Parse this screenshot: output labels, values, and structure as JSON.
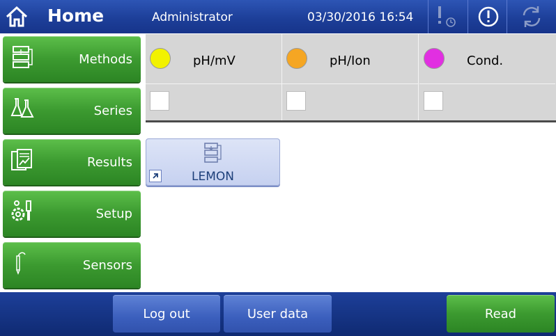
{
  "header": {
    "title": "Home",
    "user": "Administrator",
    "datetime": "03/30/2016 16:54",
    "icons": [
      "home-icon",
      "alarm-clock-icon",
      "info-icon",
      "refresh-icon"
    ]
  },
  "sidebar": {
    "items": [
      {
        "label": "Methods",
        "icon": "methods-icon"
      },
      {
        "label": "Series",
        "icon": "flasks-icon"
      },
      {
        "label": "Results",
        "icon": "results-icon"
      },
      {
        "label": "Setup",
        "icon": "setup-icon"
      },
      {
        "label": "Sensors",
        "icon": "sensor-probe-icon"
      }
    ]
  },
  "sensors": {
    "channels": [
      {
        "name": "pH/mV",
        "color": "#f2f200",
        "checked": false
      },
      {
        "name": "pH/Ion",
        "color": "#f5a623",
        "checked": false
      },
      {
        "name": "Cond.",
        "color": "#e12fe1",
        "checked": false
      }
    ]
  },
  "shortcut": {
    "label": "LEMON",
    "icon": "methods-icon"
  },
  "footer": {
    "logout": "Log out",
    "userdata": "User data",
    "read": "Read"
  },
  "colors": {
    "header_blue": "#1d3f99",
    "button_green": "#3c9a30",
    "button_blue": "#3b5fbd"
  }
}
